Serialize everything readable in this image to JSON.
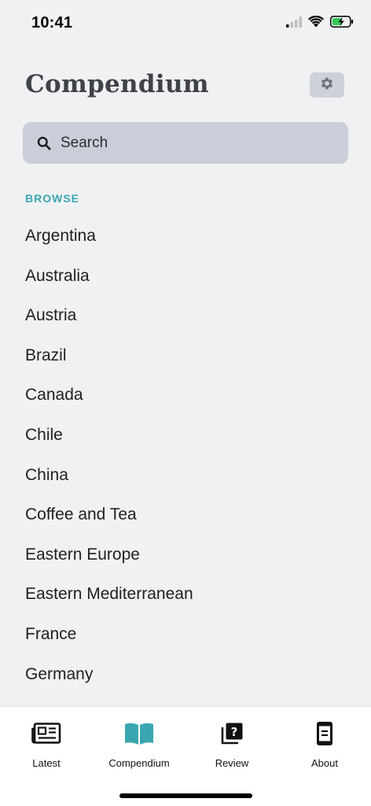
{
  "status": {
    "time": "10:41",
    "icons": [
      "signal-icon",
      "wifi-icon",
      "battery-charging-icon"
    ]
  },
  "header": {
    "title": "Compendium",
    "settings_icon": "gear-icon"
  },
  "search": {
    "placeholder": "Search",
    "icon": "search-icon"
  },
  "browse": {
    "label": "BROWSE",
    "items": [
      "Argentina",
      "Australia",
      "Austria",
      "Brazil",
      "Canada",
      "Chile",
      "China",
      "Coffee and Tea",
      "Eastern Europe",
      "Eastern Mediterranean",
      "France",
      "Germany"
    ]
  },
  "tabs": [
    {
      "label": "Latest",
      "icon": "newspaper-icon",
      "active": false
    },
    {
      "label": "Compendium",
      "icon": "open-book-icon",
      "active": true
    },
    {
      "label": "Review",
      "icon": "question-cards-icon",
      "active": false
    },
    {
      "label": "About",
      "icon": "phone-document-icon",
      "active": false
    }
  ],
  "colors": {
    "accent": "#3aa6b0",
    "background": "#f0f1f3",
    "search_bg": "#c9ced8",
    "tab_bar_bg": "#ffffff"
  }
}
